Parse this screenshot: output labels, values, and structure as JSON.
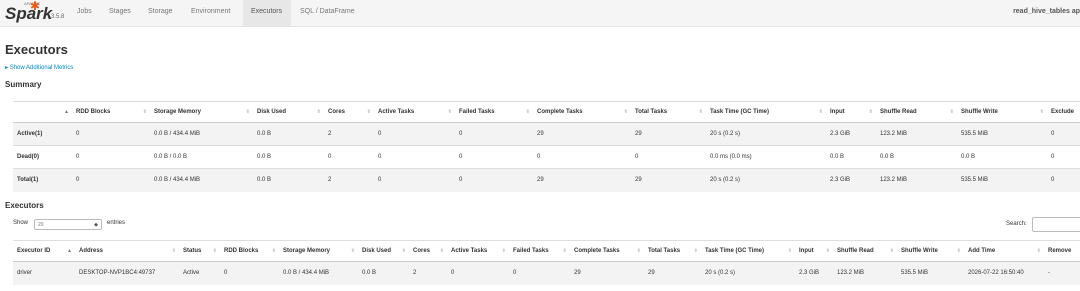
{
  "nav": {
    "logo_text": "Spark",
    "logo_small": "APACHE",
    "version": "3.5.8",
    "tabs": [
      {
        "label": "Jobs"
      },
      {
        "label": "Stages"
      },
      {
        "label": "Storage"
      },
      {
        "label": "Environment"
      },
      {
        "label": "Executors"
      },
      {
        "label": "SQL / DataFrame"
      }
    ],
    "app_name": "read_hive_tables ap"
  },
  "page_title": "Executors",
  "show_additional_metrics": "Show Additional Metrics",
  "summary": {
    "title": "Summary",
    "columns": [
      "",
      "RDD Blocks",
      "Storage Memory",
      "Disk Used",
      "Cores",
      "Active Tasks",
      "Failed Tasks",
      "Complete Tasks",
      "Total Tasks",
      "Task Time (GC Time)",
      "Input",
      "Shuffle Read",
      "Shuffle Write",
      "Exclude"
    ],
    "rows": [
      [
        "Active(1)",
        "0",
        "0.0 B / 434.4 MiB",
        "0.0 B",
        "2",
        "0",
        "0",
        "29",
        "29",
        "20 s (0.2 s)",
        "2.3 GiB",
        "123.2 MiB",
        "535.5 MiB",
        "0"
      ],
      [
        "Dead(0)",
        "0",
        "0.0 B / 0.0 B",
        "0.0 B",
        "0",
        "0",
        "0",
        "0",
        "0",
        "0.0 ms (0.0 ms)",
        "0.0 B",
        "0.0 B",
        "0.0 B",
        "0"
      ],
      [
        "Total(1)",
        "0",
        "0.0 B / 434.4 MiB",
        "0.0 B",
        "2",
        "0",
        "0",
        "29",
        "29",
        "20 s (0.2 s)",
        "2.3 GiB",
        "123.2 MiB",
        "535.5 MiB",
        "0"
      ]
    ]
  },
  "executors": {
    "title": "Executors",
    "show_label": "Show",
    "page_size": "20",
    "entries_label": "entries",
    "search_label": "Search:",
    "search_value": "",
    "columns": [
      "Executor ID",
      "Address",
      "Status",
      "RDD Blocks",
      "Storage Memory",
      "Disk Used",
      "Cores",
      "Active Tasks",
      "Failed Tasks",
      "Complete Tasks",
      "Total Tasks",
      "Task Time (GC Time)",
      "Input",
      "Shuffle Read",
      "Shuffle Write",
      "Add Time",
      "Remove"
    ],
    "rows": [
      [
        "driver",
        "DESKTOP-NVP1BC4:49737",
        "Active",
        "0",
        "0.0 B / 434.4 MiB",
        "0.0 B",
        "2",
        "0",
        "0",
        "29",
        "29",
        "20 s (0.2 s)",
        "2.3 GiB",
        "123.2 MiB",
        "535.5 MiB",
        "2026-07-22 16:50:40",
        "-"
      ]
    ]
  }
}
